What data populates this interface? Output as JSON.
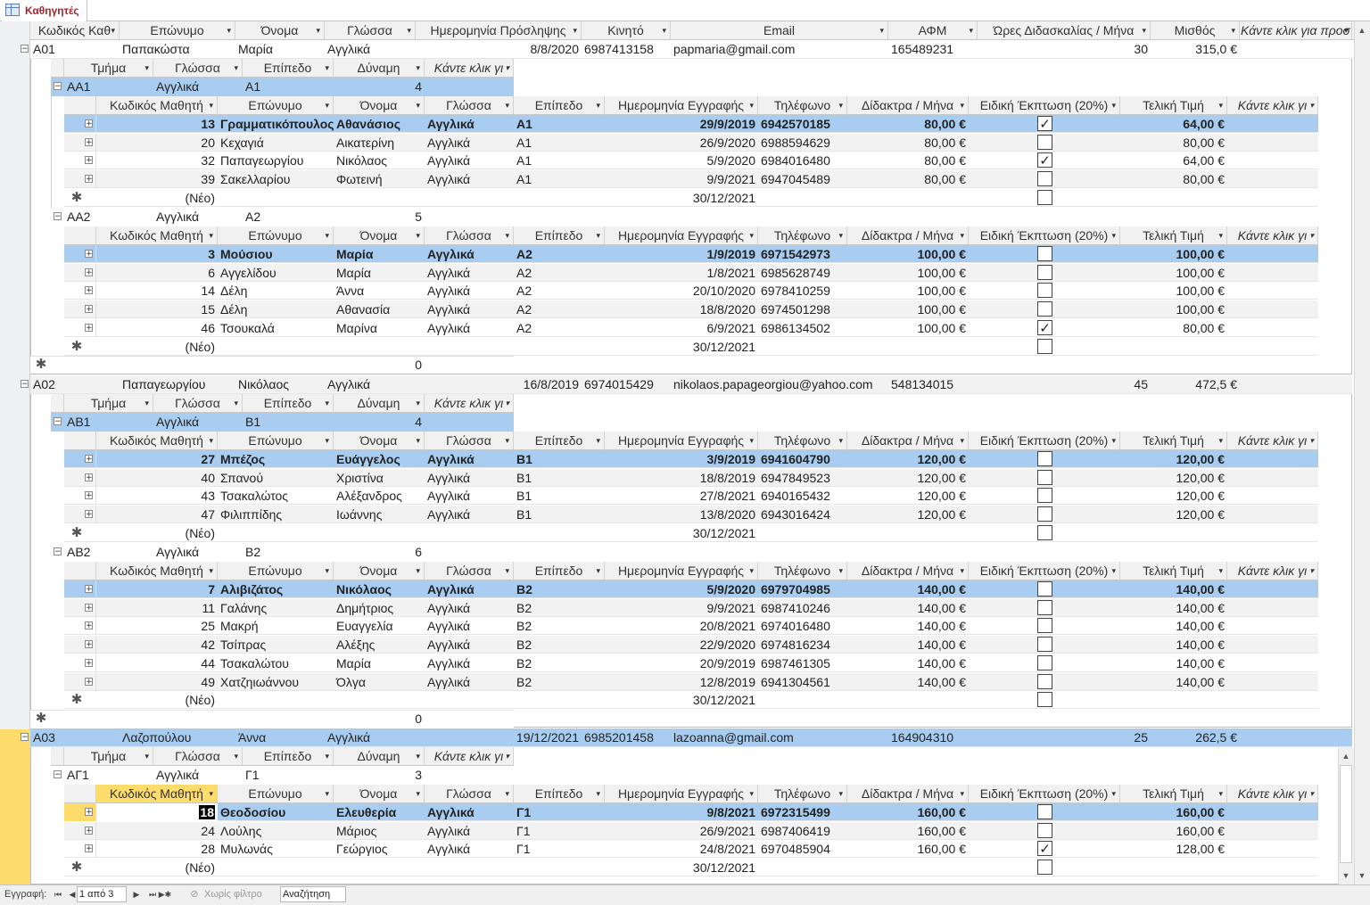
{
  "window": {
    "tab_title": "Καθηγητές",
    "tab_icon": "table-icon"
  },
  "teacher_columns": [
    "Κωδικός Καθ",
    "Επώνυμο",
    "Όνομα",
    "Γλώσσα",
    "Ημερομηνία Πρόσληψης",
    "Κινητό",
    "Email",
    "ΑΦΜ",
    "Ώρες Διδασκαλίας / Μήνα",
    "Μισθός",
    "Κάντε κλικ για προσ"
  ],
  "section_columns": [
    "Τμήμα",
    "Γλώσσα",
    "Επίπεδο",
    "Δύναμη",
    "Κάντε κλικ γι"
  ],
  "student_columns": [
    "Κωδικός Μαθητή",
    "Επώνυμο",
    "Όνομα",
    "Γλώσσα",
    "Επίπεδο",
    "Ημερομηνία Εγγραφής",
    "Τηλέφωνο",
    "Δίδακτρα / Μήνα",
    "Ειδική Έκπτωση (20%)",
    "Τελική Τιμή",
    "Κάντε κλικ γι"
  ],
  "new_label": "(Νέο)",
  "new_date": "30/12/2021",
  "zero": "0",
  "teachers": [
    {
      "code": "Α01",
      "last": "Παπακώστα",
      "first": "Μαρία",
      "lang": "Αγγλικά",
      "hired": "8/8/2020",
      "mobile": "6987413158",
      "email": "papmaria@gmail.com",
      "afm": "165489231",
      "hours": "30",
      "salary": "315,0 €"
    },
    {
      "code": "Α02",
      "last": "Παπαγεωργίου",
      "first": "Νικόλαος",
      "lang": "Αγγλικά",
      "hired": "16/8/2019",
      "mobile": "6974015429",
      "email": "nikolaos.papageorgiou@yahoo.com",
      "afm": "548134015",
      "hours": "45",
      "salary": "472,5 €"
    },
    {
      "code": "Α03",
      "last": "Λαζοπούλου",
      "first": "Άννα",
      "lang": "Αγγλικά",
      "hired": "19/12/2021",
      "mobile": "6985201458",
      "email": "lazoanna@gmail.com",
      "afm": "164904310",
      "hours": "25",
      "salary": "262,5 €"
    }
  ],
  "sections": [
    {
      "code": "ΑΑ1",
      "lang": "Αγγλικά",
      "level": "Α1",
      "count": "4",
      "students": [
        {
          "id": "13",
          "last": "Γραμματικόπουλος",
          "first": "Αθανάσιος",
          "lang": "Αγγλικά",
          "level": "Α1",
          "date": "29/9/2019",
          "phone": "6942570185",
          "fee": "80,00 €",
          "disc": true,
          "final": "64,00 €"
        },
        {
          "id": "20",
          "last": "Κεχαγιά",
          "first": "Αικατερίνη",
          "lang": "Αγγλικά",
          "level": "Α1",
          "date": "26/9/2020",
          "phone": "6988594629",
          "fee": "80,00 €",
          "disc": false,
          "final": "80,00 €"
        },
        {
          "id": "32",
          "last": "Παπαγεωργίου",
          "first": "Νικόλαος",
          "lang": "Αγγλικά",
          "level": "Α1",
          "date": "5/9/2020",
          "phone": "6984016480",
          "fee": "80,00 €",
          "disc": true,
          "final": "64,00 €"
        },
        {
          "id": "39",
          "last": "Σακελλαρίου",
          "first": "Φωτεινή",
          "lang": "Αγγλικά",
          "level": "Α1",
          "date": "9/9/2021",
          "phone": "6947045489",
          "fee": "80,00 €",
          "disc": false,
          "final": "80,00 €"
        }
      ]
    },
    {
      "code": "ΑΑ2",
      "lang": "Αγγλικά",
      "level": "Α2",
      "count": "5",
      "students": [
        {
          "id": "3",
          "last": "Μούσιου",
          "first": "Μαρία",
          "lang": "Αγγλικά",
          "level": "Α2",
          "date": "1/9/2019",
          "phone": "6971542973",
          "fee": "100,00 €",
          "disc": false,
          "final": "100,00 €"
        },
        {
          "id": "6",
          "last": "Αγγελίδου",
          "first": "Μαρία",
          "lang": "Αγγλικά",
          "level": "Α2",
          "date": "1/8/2021",
          "phone": "6985628749",
          "fee": "100,00 €",
          "disc": false,
          "final": "100,00 €"
        },
        {
          "id": "14",
          "last": "Δέλη",
          "first": "Άννα",
          "lang": "Αγγλικά",
          "level": "Α2",
          "date": "20/10/2020",
          "phone": "6978410259",
          "fee": "100,00 €",
          "disc": false,
          "final": "100,00 €"
        },
        {
          "id": "15",
          "last": "Δέλη",
          "first": "Αθανασία",
          "lang": "Αγγλικά",
          "level": "Α2",
          "date": "18/8/2020",
          "phone": "6974501298",
          "fee": "100,00 €",
          "disc": false,
          "final": "100,00 €"
        },
        {
          "id": "46",
          "last": "Τσουκαλά",
          "first": "Μαρίνα",
          "lang": "Αγγλικά",
          "level": "Α2",
          "date": "6/9/2021",
          "phone": "6986134502",
          "fee": "100,00 €",
          "disc": true,
          "final": "80,00 €"
        }
      ]
    },
    {
      "code": "ΑΒ1",
      "lang": "Αγγλικά",
      "level": "Β1",
      "count": "4",
      "students": [
        {
          "id": "27",
          "last": "Μπέζος",
          "first": "Ευάγγελος",
          "lang": "Αγγλικά",
          "level": "Β1",
          "date": "3/9/2019",
          "phone": "6941604790",
          "fee": "120,00 €",
          "disc": false,
          "final": "120,00 €"
        },
        {
          "id": "40",
          "last": "Σπανού",
          "first": "Χριστίνα",
          "lang": "Αγγλικά",
          "level": "Β1",
          "date": "18/8/2019",
          "phone": "6947849523",
          "fee": "120,00 €",
          "disc": false,
          "final": "120,00 €"
        },
        {
          "id": "43",
          "last": "Τσακαλώτος",
          "first": "Αλέξανδρος",
          "lang": "Αγγλικά",
          "level": "Β1",
          "date": "27/8/2021",
          "phone": "6940165432",
          "fee": "120,00 €",
          "disc": false,
          "final": "120,00 €"
        },
        {
          "id": "47",
          "last": "Φιλιππίδης",
          "first": "Ιωάννης",
          "lang": "Αγγλικά",
          "level": "Β1",
          "date": "13/8/2020",
          "phone": "6943016424",
          "fee": "120,00 €",
          "disc": false,
          "final": "120,00 €"
        }
      ]
    },
    {
      "code": "ΑΒ2",
      "lang": "Αγγλικά",
      "level": "Β2",
      "count": "6",
      "students": [
        {
          "id": "7",
          "last": "Αλιβιζάτος",
          "first": "Νικόλαος",
          "lang": "Αγγλικά",
          "level": "Β2",
          "date": "5/9/2020",
          "phone": "6979704985",
          "fee": "140,00 €",
          "disc": false,
          "final": "140,00 €"
        },
        {
          "id": "11",
          "last": "Γαλάνης",
          "first": "Δημήτριος",
          "lang": "Αγγλικά",
          "level": "Β2",
          "date": "9/9/2021",
          "phone": "6987410246",
          "fee": "140,00 €",
          "disc": false,
          "final": "140,00 €"
        },
        {
          "id": "25",
          "last": "Μακρή",
          "first": "Ευαγγελία",
          "lang": "Αγγλικά",
          "level": "Β2",
          "date": "20/8/2021",
          "phone": "6974016480",
          "fee": "140,00 €",
          "disc": false,
          "final": "140,00 €"
        },
        {
          "id": "42",
          "last": "Τσίπρας",
          "first": "Αλέξης",
          "lang": "Αγγλικά",
          "level": "Β2",
          "date": "22/9/2020",
          "phone": "6974816234",
          "fee": "140,00 €",
          "disc": false,
          "final": "140,00 €"
        },
        {
          "id": "44",
          "last": "Τσακαλώτου",
          "first": "Μαρία",
          "lang": "Αγγλικά",
          "level": "Β2",
          "date": "20/9/2019",
          "phone": "6987461305",
          "fee": "140,00 €",
          "disc": false,
          "final": "140,00 €"
        },
        {
          "id": "49",
          "last": "Χατζηιωάννου",
          "first": "Όλγα",
          "lang": "Αγγλικά",
          "level": "Β2",
          "date": "12/8/2019",
          "phone": "6941304561",
          "fee": "140,00 €",
          "disc": false,
          "final": "140,00 €"
        }
      ]
    },
    {
      "code": "ΑΓ1",
      "lang": "Αγγλικά",
      "level": "Γ1",
      "count": "3",
      "students": [
        {
          "id": "18",
          "last": "Θεοδοσίου",
          "first": "Ελευθερία",
          "lang": "Αγγλικά",
          "level": "Γ1",
          "date": "9/8/2021",
          "phone": "6972315499",
          "fee": "160,00 €",
          "disc": false,
          "final": "160,00 €"
        },
        {
          "id": "24",
          "last": "Λούλης",
          "first": "Μάριος",
          "lang": "Αγγλικά",
          "level": "Γ1",
          "date": "26/9/2021",
          "phone": "6987406419",
          "fee": "160,00 €",
          "disc": false,
          "final": "160,00 €"
        },
        {
          "id": "28",
          "last": "Μυλωνάς",
          "first": "Γεώργιος",
          "lang": "Αγγλικά",
          "level": "Γ1",
          "date": "24/8/2021",
          "phone": "6970485904",
          "fee": "160,00 €",
          "disc": true,
          "final": "128,00 €"
        }
      ]
    }
  ],
  "status_bar": {
    "record_label": "Εγγραφή:",
    "record_position": "1 από 3",
    "filter_label": "Χωρίς φίλτρο",
    "search_label": "Αναζήτηση"
  },
  "colors": {
    "selected_row": "#a9cdf0",
    "current_record_marker": "#fddc6c",
    "tab_title": "#a4262c"
  }
}
